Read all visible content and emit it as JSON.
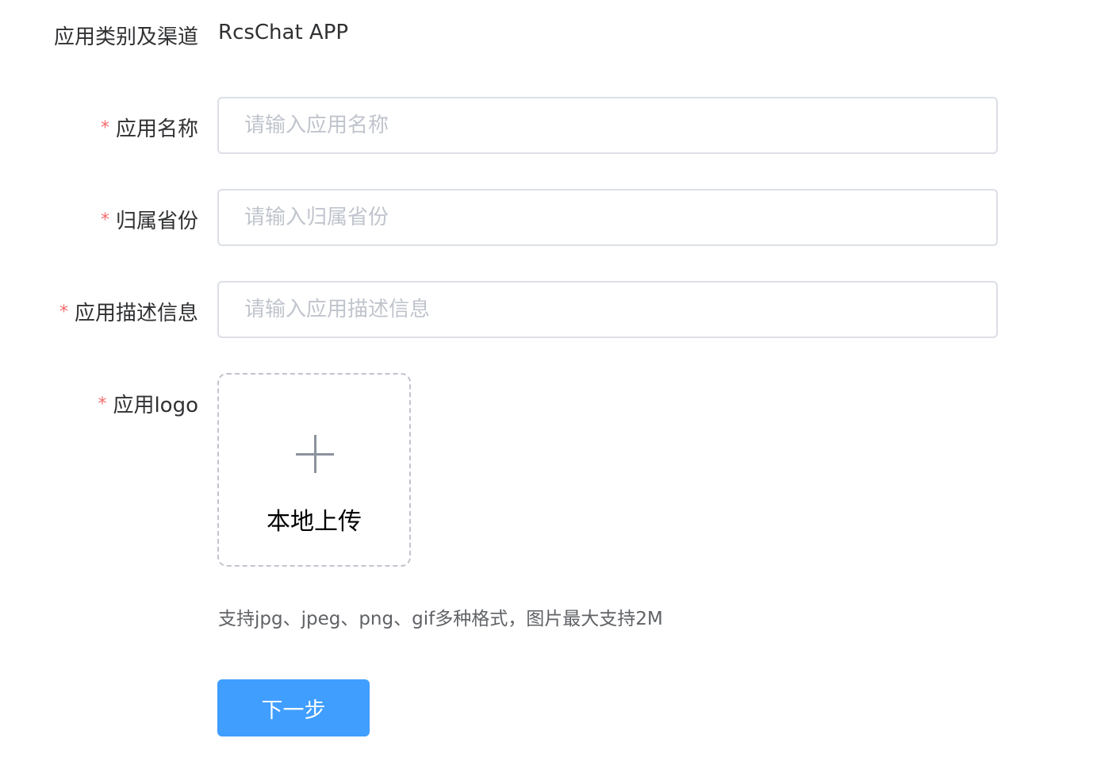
{
  "form": {
    "category": {
      "label": "应用类别及渠道",
      "value": "RcsChat APP"
    },
    "app_name": {
      "required_mark": "*",
      "label": "应用名称",
      "placeholder": "请输入应用名称",
      "value": ""
    },
    "province": {
      "required_mark": "*",
      "label": "归属省份",
      "placeholder": "请输入归属省份",
      "value": ""
    },
    "description": {
      "required_mark": "*",
      "label": "应用描述信息",
      "placeholder": "请输入应用描述信息",
      "value": ""
    },
    "logo": {
      "required_mark": "*",
      "label": "应用logo",
      "upload_icon": "plus-icon",
      "upload_label": "本地上传",
      "hint": "支持jpg、jpeg、png、gif多种格式，图片最大支持2M"
    },
    "next_button_label": "下一步"
  },
  "colors": {
    "required": "#f56c6c",
    "primary_button": "#409eff",
    "border": "#dcdfe6",
    "placeholder": "#c0c4cc"
  }
}
